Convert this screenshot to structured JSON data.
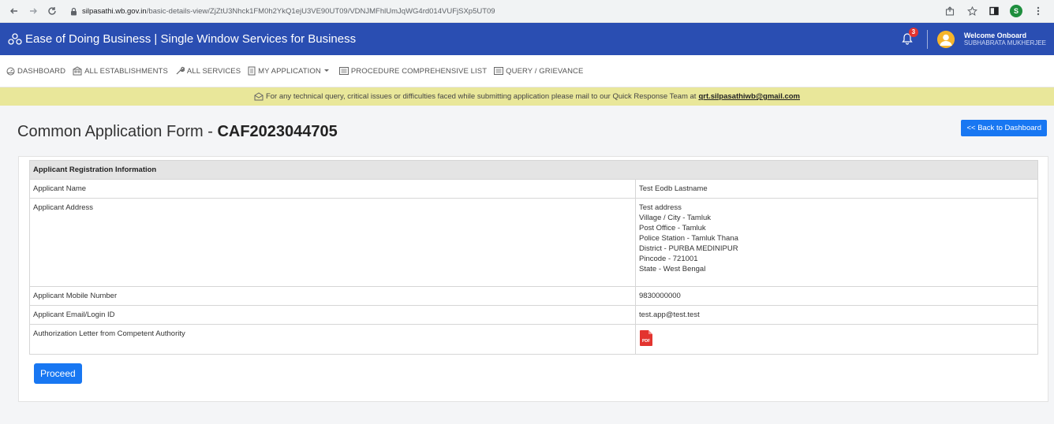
{
  "browser": {
    "url_host": "silpasathi.wb.gov.in",
    "url_path": "/basic-details-view/ZjZtU3Nhck1FM0h2YkQ1ejU3VE90UT09/VDNJMFhlUmJqWG4rd014VUFjSXp5UT09",
    "profile_initial": "S"
  },
  "header": {
    "title": "Ease of Doing Business | Single Window Services for Business",
    "notification_count": "3",
    "welcome": "Welcome Onboard",
    "username": "SUBHABRATA MUKHERJEE"
  },
  "nav": {
    "items": [
      {
        "label": "DASHBOARD",
        "icon": "dashboard-icon"
      },
      {
        "label": "ALL ESTABLISHMENTS",
        "icon": "building-icon"
      },
      {
        "label": "ALL SERVICES",
        "icon": "wrench-icon"
      },
      {
        "label": "MY APPLICATION",
        "icon": "document-icon"
      },
      {
        "label": "PROCEDURE COMPREHENSIVE LIST",
        "icon": "list-icon"
      },
      {
        "label": "QUERY / GRIEVANCE",
        "icon": "list-icon"
      }
    ]
  },
  "notice": {
    "text": "For any technical query, critical issues or difficulties faced while submitting application please mail to our Quick Response Team at",
    "email": "qrt.silpasathiwb@gmail.com"
  },
  "page": {
    "title_prefix": "Common Application Form -",
    "caf_code": "CAF2023044705",
    "back_label": "<< Back to Dashboard"
  },
  "table": {
    "heading": "Applicant Registration Information",
    "rows": [
      {
        "label": "Applicant Name",
        "value": [
          "Test Eodb Lastname"
        ]
      },
      {
        "label": "Applicant Address",
        "value": [
          "Test address",
          "Village / City - Tamluk",
          "Post Office - Tamluk",
          "Police Station - Tamluk Thana",
          "District - PURBA MEDINIPUR",
          "Pincode - 721001",
          "State - West Bengal"
        ]
      },
      {
        "label": "Applicant Mobile Number",
        "value": [
          "9830000000"
        ]
      },
      {
        "label": "Applicant Email/Login ID",
        "value": [
          "test.app@test.test"
        ]
      },
      {
        "label": "Authorization Letter from Competent Authority",
        "pdf_label": "PDF"
      }
    ]
  },
  "actions": {
    "proceed_label": "Proceed"
  },
  "colors": {
    "header_bg": "#2a4eb2",
    "notice_bg": "#e9e79a",
    "button_blue": "#1877f2",
    "pdf_red": "#e3342f"
  }
}
